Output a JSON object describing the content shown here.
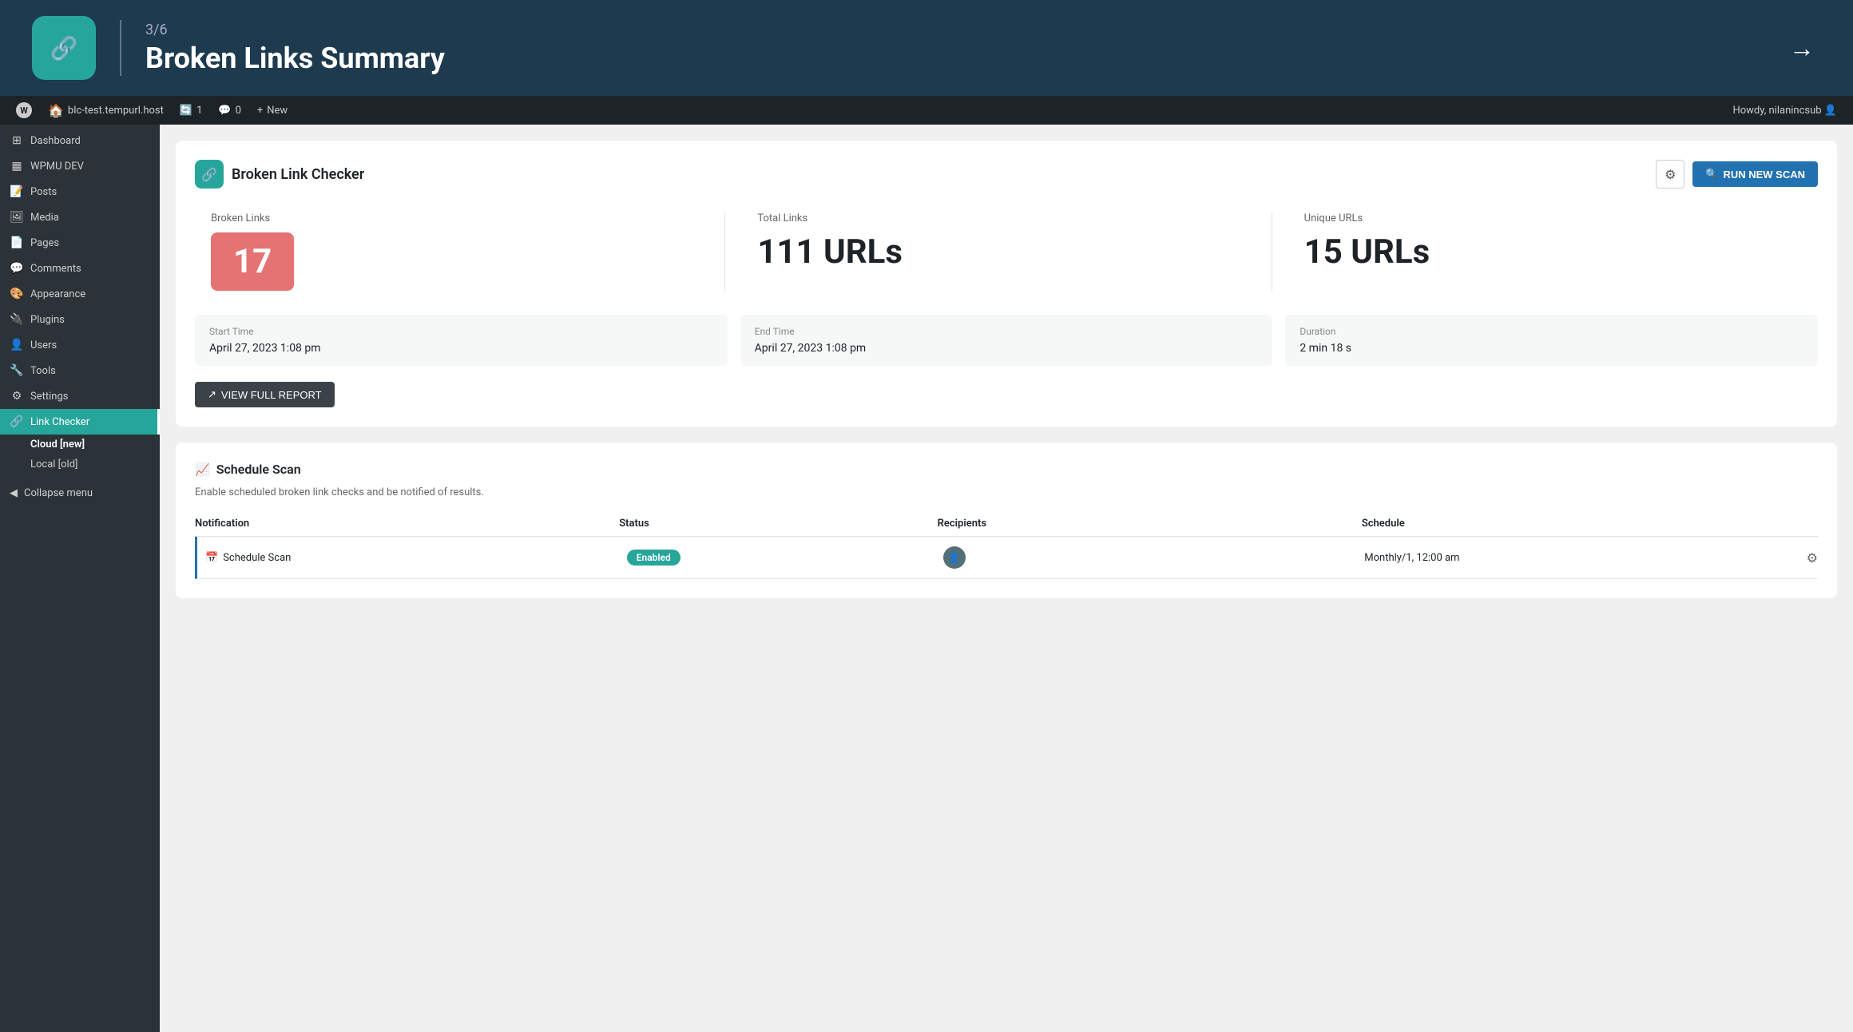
{
  "header": {
    "step": "3/6",
    "title": "Broken Links Summary",
    "logo_emoji": "🔗",
    "arrow": "→"
  },
  "admin_bar": {
    "wp_label": "W",
    "site_url": "blc-test.tempurl.host",
    "update_count": "1",
    "comment_count": "0",
    "new_label": "New",
    "howdy": "Howdy, nilanincsub"
  },
  "sidebar": {
    "items": [
      {
        "label": "Dashboard",
        "icon": "⊞"
      },
      {
        "label": "WPMU DEV",
        "icon": "▦"
      },
      {
        "label": "Posts",
        "icon": "📝"
      },
      {
        "label": "Media",
        "icon": "🖼"
      },
      {
        "label": "Pages",
        "icon": "📄"
      },
      {
        "label": "Comments",
        "icon": "💬"
      },
      {
        "label": "Appearance",
        "icon": "🎨"
      },
      {
        "label": "Plugins",
        "icon": "🔌"
      },
      {
        "label": "Users",
        "icon": "👤"
      },
      {
        "label": "Tools",
        "icon": "🔧"
      },
      {
        "label": "Settings",
        "icon": "⚙"
      },
      {
        "label": "Link Checker",
        "icon": "🔗"
      }
    ],
    "sub_items": [
      {
        "label": "Cloud [new]",
        "active": true
      },
      {
        "label": "Local [old]",
        "active": false
      }
    ],
    "collapse_label": "Collapse menu"
  },
  "blc": {
    "plugin_name": "Broken Link Checker",
    "logo_emoji": "🔗",
    "run_scan_label": "RUN NEW SCAN",
    "settings_icon": "⚙"
  },
  "stats": {
    "broken_links_label": "Broken Links",
    "broken_links_value": "17",
    "total_links_label": "Total Links",
    "total_links_value": "111 URLs",
    "unique_urls_label": "Unique URLs",
    "unique_urls_value": "15 URLs"
  },
  "timing": {
    "start_label": "Start Time",
    "start_value": "April 27, 2023 1:08 pm",
    "end_label": "End Time",
    "end_value": "April 27, 2023 1:08 pm",
    "duration_label": "Duration",
    "duration_value": "2 min 18 s"
  },
  "view_report": {
    "label": "VIEW FULL REPORT",
    "icon": "↗"
  },
  "schedule": {
    "title": "Schedule Scan",
    "description": "Enable scheduled broken link checks and be notified of results.",
    "icon": "📈",
    "table": {
      "headers": [
        "Notification",
        "Status",
        "Recipients",
        "Schedule"
      ],
      "rows": [
        {
          "notification": "Schedule Scan",
          "notification_icon": "📅",
          "status": "Enabled",
          "recipients_avatar": "👤",
          "schedule": "Monthly/1, 12:00 am"
        }
      ]
    }
  }
}
